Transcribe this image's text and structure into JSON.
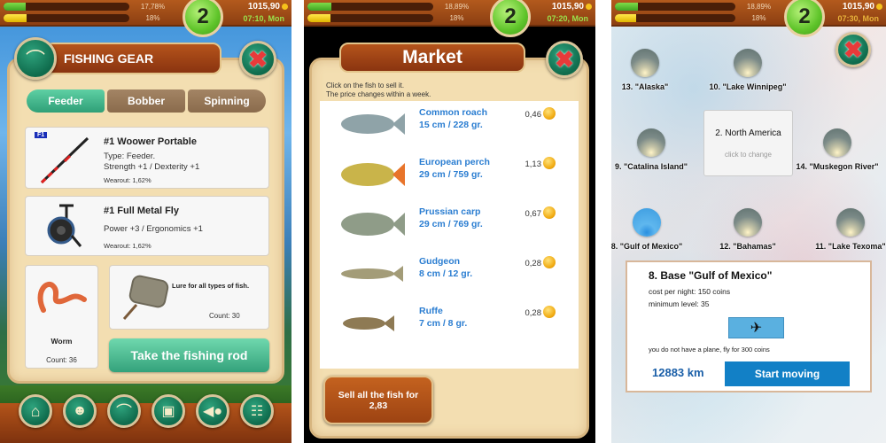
{
  "screens": [
    {
      "hud": {
        "bar1_pct": "17,78%",
        "bar1_value": 0.1778,
        "bar2_pct": "18%",
        "bar2_value": 0.18,
        "level": "2",
        "coins": "1015,90",
        "time": "07:10, Mon"
      },
      "title": "FISHING GEAR",
      "tabs": [
        "Feeder",
        "Bobber",
        "Spinning"
      ],
      "active_tab": "Feeder",
      "rod": {
        "badge": "F1",
        "name": "#1 Woower Portable",
        "type": "Type: Feeder.",
        "stats": "Strength +1 / Dexterity +1",
        "wearout": "Wearout: 1,62%"
      },
      "reel": {
        "name": "#1 Full Metal Fly",
        "stats": "Power +3 / Ergonomics +1",
        "wearout": "Wearout: 1,62%"
      },
      "bait": {
        "name": "Worm",
        "count": "Count: 36"
      },
      "lure": {
        "description": "Lure for all types of fish.",
        "count": "Count: 30"
      },
      "action_button": "Take the fishing rod",
      "nav_icons": [
        "home-icon",
        "profile-icon",
        "fishing-rod-icon",
        "briefcase-icon",
        "fish-icon",
        "book-icon"
      ]
    },
    {
      "hud": {
        "bar1_pct": "18,89%",
        "bar1_value": 0.1889,
        "bar2_pct": "18%",
        "bar2_value": 0.18,
        "level": "2",
        "coins": "1015,90",
        "time": "07:20, Mon"
      },
      "title": "Market",
      "hint_line1": "Click on the fish to sell it.",
      "hint_line2": "The price changes within a week.",
      "fish": [
        {
          "name": "Common roach",
          "size": "15 cm / 228 gr.",
          "price": "0,46",
          "color": "#8fa3a8"
        },
        {
          "name": "European perch",
          "size": "29 cm / 759 gr.",
          "price": "1,13",
          "color": "#c9b44a"
        },
        {
          "name": "Prussian carp",
          "size": "29 cm / 769 gr.",
          "price": "0,67",
          "color": "#8f9c88"
        },
        {
          "name": "Gudgeon",
          "size": "8 cm / 12 gr.",
          "price": "0,28",
          "color": "#a39c78"
        },
        {
          "name": "Ruffe",
          "size": "7 cm / 8 gr.",
          "price": "0,28",
          "color": "#8e7a54"
        }
      ],
      "sell_all_line1": "Sell all the fish for",
      "sell_all_line2": "2,83"
    },
    {
      "hud": {
        "bar1_pct": "18,89%",
        "bar1_value": 0.1889,
        "bar2_pct": "18%",
        "bar2_value": 0.18,
        "level": "2",
        "coins": "1015,90",
        "time": "07:30, Mon"
      },
      "locations": [
        {
          "label": "13. \"Alaska\"",
          "active": false
        },
        {
          "label": "10. \"Lake Winnipeg\"",
          "active": false
        },
        {
          "label": "9. \"Catalina Island\"",
          "active": false
        },
        {
          "label": "14. \"Muskegon River\"",
          "active": false
        },
        {
          "label": "8. \"Gulf of Mexico\"",
          "active": true
        },
        {
          "label": "12. \"Bahamas\"",
          "active": false
        },
        {
          "label": "11. \"Lake Texoma\"",
          "active": false
        }
      ],
      "region": {
        "name": "2. North America",
        "hint": "click to change"
      },
      "base": {
        "title": "8. Base \"Gulf of Mexico\"",
        "cost": "cost per night: 150 coins",
        "min_level": "minimum level: 35",
        "plane_note": "you do not have a plane, fly for 300 coins",
        "distance": "12883 km",
        "start_button": "Start moving"
      }
    }
  ]
}
